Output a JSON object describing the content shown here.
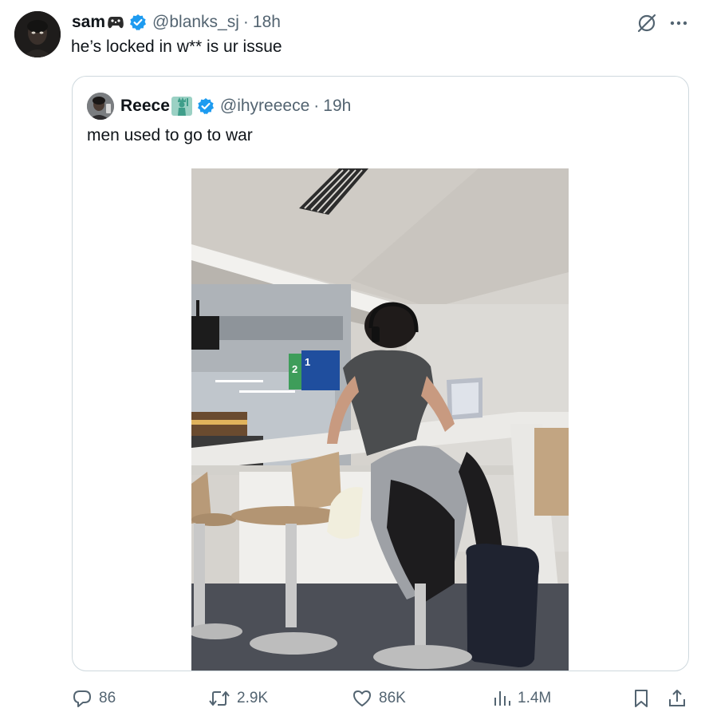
{
  "tweet": {
    "author_name": "sam",
    "author_emoji": "controller-skull-icon",
    "handle": "@blanks_sj",
    "separator": "·",
    "time": "18h",
    "text": "he’s locked in w** is ur issue"
  },
  "quoted": {
    "author_name": "Reece",
    "author_emoji": "statue-of-liberty-icon",
    "handle": "@ihyreeece",
    "separator": "·",
    "time": "19h",
    "text": "men used to go to war"
  },
  "gate_signs": {
    "number_left": "2",
    "number_right": "1"
  },
  "actions": {
    "replies": "86",
    "reposts": "2.9K",
    "likes": "86K",
    "views": "1.4M"
  },
  "colors": {
    "verified": "#1d9bf0",
    "secondary_text": "#536471",
    "border": "#cfd9de"
  }
}
